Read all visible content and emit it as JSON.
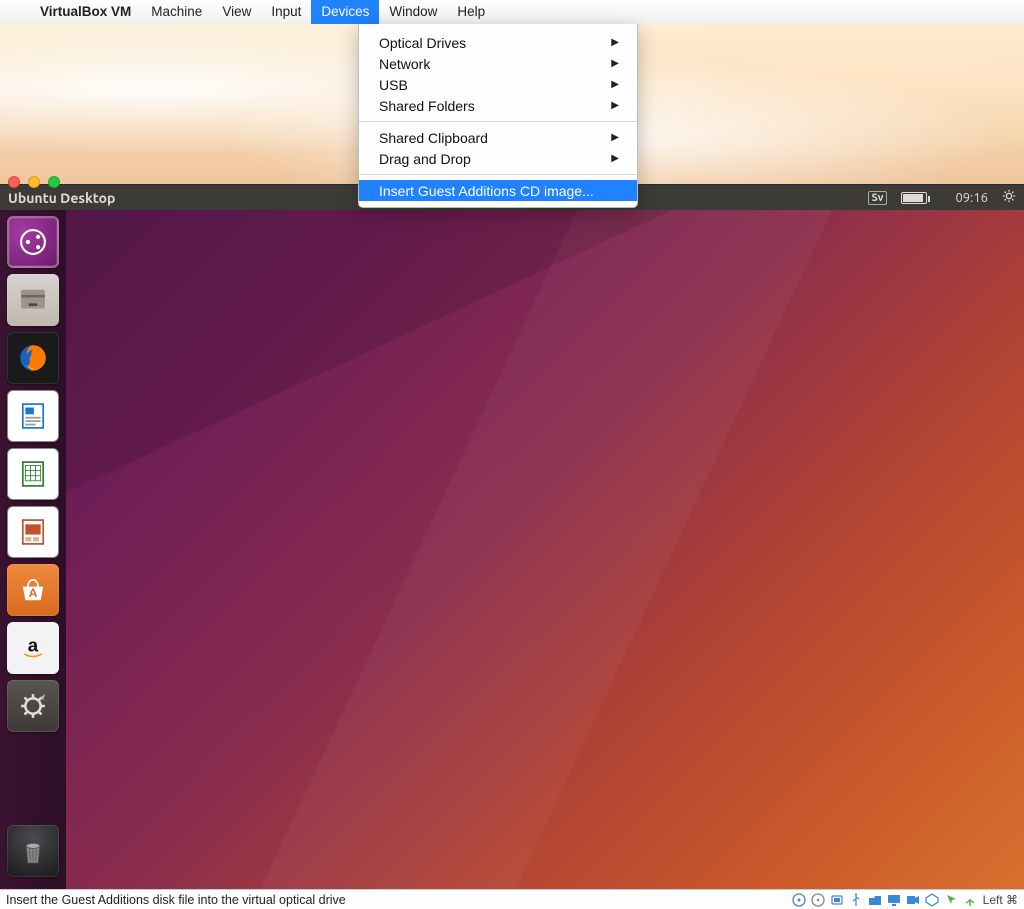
{
  "mac_menu": {
    "app": "VirtualBox VM",
    "items": [
      "Machine",
      "View",
      "Input",
      "Devices",
      "Window",
      "Help"
    ],
    "active": "Devices"
  },
  "dropdown": {
    "group1": [
      {
        "label": "Optical Drives",
        "submenu": true
      },
      {
        "label": "Network",
        "submenu": true
      },
      {
        "label": "USB",
        "submenu": true
      },
      {
        "label": "Shared Folders",
        "submenu": true
      }
    ],
    "group2": [
      {
        "label": "Shared Clipboard",
        "submenu": true
      },
      {
        "label": "Drag and Drop",
        "submenu": true
      }
    ],
    "group3": [
      {
        "label": "Insert Guest Additions CD image...",
        "submenu": false,
        "selected": true
      }
    ]
  },
  "ubuntu": {
    "panel_title": "Ubuntu Desktop",
    "keyboard_layout": "Sv",
    "clock": "09:16"
  },
  "launcher": {
    "dash": "Dash",
    "files": "Files",
    "firefox": "Firefox",
    "writer": "LibreOffice Writer",
    "calc": "LibreOffice Calc",
    "impress": "LibreOffice Impress",
    "software": "Ubuntu Software",
    "amazon": "Amazon",
    "settings": "System Settings",
    "trash": "Trash"
  },
  "statusbar": {
    "message": "Insert the Guest Additions disk file into the virtual optical drive",
    "host_key": "Left ⌘"
  }
}
